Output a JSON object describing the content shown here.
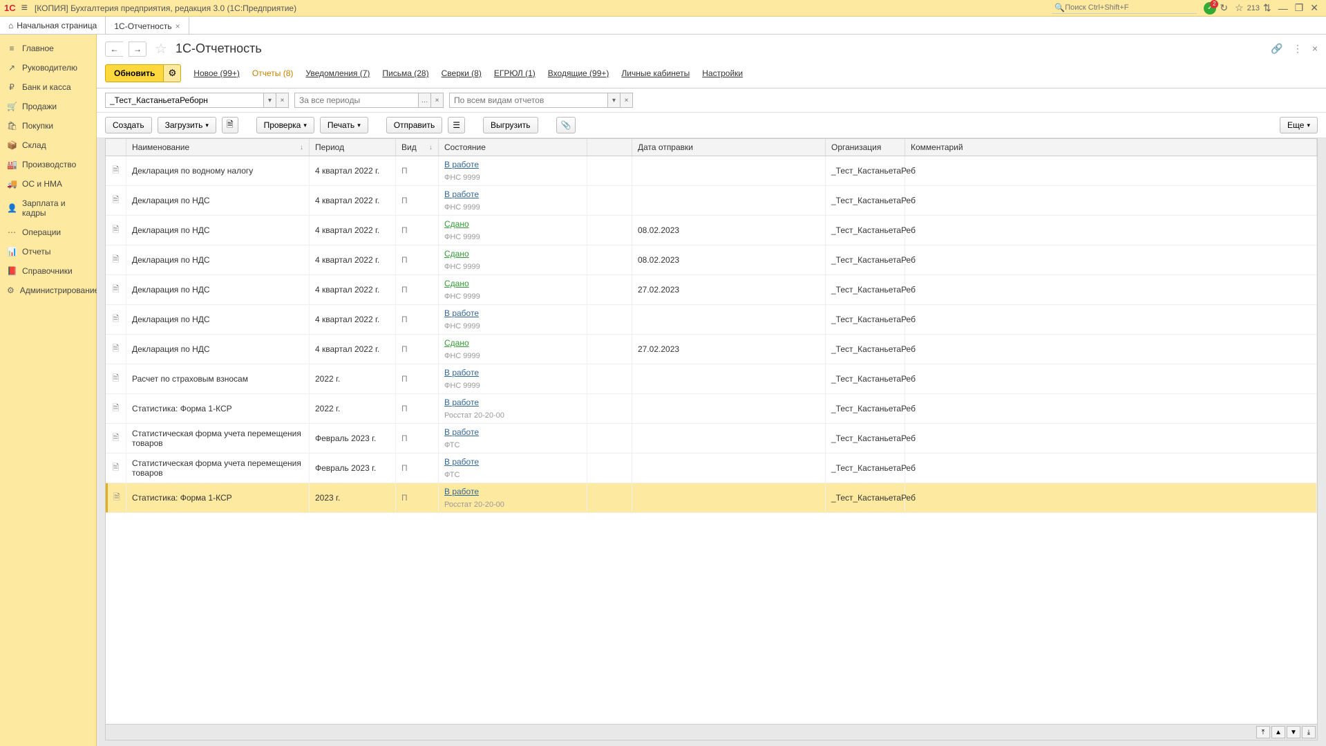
{
  "titlebar": {
    "logo": "1C",
    "title": "[КОПИЯ] Бухгалтерия предприятия, редакция 3.0  (1С:Предприятие)",
    "search_placeholder": "Поиск Ctrl+Shift+F",
    "notif_badge": "2",
    "count": "213"
  },
  "tabs": {
    "home": "Начальная страница",
    "active": "1С-Отчетность"
  },
  "sidebar": {
    "items": [
      {
        "icon": "≡",
        "label": "Главное"
      },
      {
        "icon": "↗",
        "label": "Руководителю"
      },
      {
        "icon": "₽",
        "label": "Банк и касса"
      },
      {
        "icon": "🛒",
        "label": "Продажи"
      },
      {
        "icon": "🛍",
        "label": "Покупки"
      },
      {
        "icon": "📦",
        "label": "Склад"
      },
      {
        "icon": "🏭",
        "label": "Производство"
      },
      {
        "icon": "🚚",
        "label": "ОС и НМА"
      },
      {
        "icon": "👤",
        "label": "Зарплата и кадры"
      },
      {
        "icon": "⋯",
        "label": "Операции"
      },
      {
        "icon": "📊",
        "label": "Отчеты"
      },
      {
        "icon": "📕",
        "label": "Справочники"
      },
      {
        "icon": "⚙",
        "label": "Администрирование"
      }
    ]
  },
  "page": {
    "title": "1С-Отчетность",
    "nav": {
      "refresh": "Обновить",
      "new": "Новое (99+)",
      "reports": "Отчеты (8)",
      "notifications": "Уведомления (7)",
      "letters": "Письма (28)",
      "checks": "Сверки (8)",
      "egrul": "ЕГРЮЛ (1)",
      "incoming": "Входящие (99+)",
      "cabinets": "Личные кабинеты",
      "settings": "Настройки"
    },
    "filters": {
      "org_value": "_Тест_КастаньетаРеборн",
      "period_placeholder": "За все периоды",
      "types_placeholder": "По всем видам отчетов"
    },
    "toolbar": {
      "create": "Создать",
      "load": "Загрузить",
      "check": "Проверка",
      "print": "Печать",
      "send": "Отправить",
      "export": "Выгрузить",
      "more": "Еще"
    },
    "columns": {
      "name": "Наименование",
      "period": "Период",
      "type": "Вид",
      "status": "Состояние",
      "date": "Дата отправки",
      "org": "Организация",
      "comment": "Комментарий"
    },
    "rows": [
      {
        "name": "Декларация по водному налогу",
        "period": "4 квартал 2022 г.",
        "type": "П",
        "status": "В работе",
        "status_color": "blue",
        "sub": "ФНС 9999",
        "date": "",
        "org": "_Тест_КастаньетаРеб"
      },
      {
        "name": "Декларация по НДС",
        "period": "4 квартал 2022 г.",
        "type": "П",
        "status": "В работе",
        "status_color": "blue",
        "sub": "ФНС 9999",
        "date": "",
        "org": "_Тест_КастаньетаРеб"
      },
      {
        "name": "Декларация по НДС",
        "period": "4 квартал 2022 г.",
        "type": "П",
        "status": "Сдано",
        "status_color": "green",
        "sub": "ФНС 9999",
        "date": "08.02.2023",
        "org": "_Тест_КастаньетаРеб"
      },
      {
        "name": "Декларация по НДС",
        "period": "4 квартал 2022 г.",
        "type": "П",
        "status": "Сдано",
        "status_color": "green",
        "sub": "ФНС 9999",
        "date": "08.02.2023",
        "org": "_Тест_КастаньетаРеб"
      },
      {
        "name": "Декларация по НДС",
        "period": "4 квартал 2022 г.",
        "type": "П",
        "status": "Сдано",
        "status_color": "green",
        "sub": "ФНС 9999",
        "date": "27.02.2023",
        "org": "_Тест_КастаньетаРеб"
      },
      {
        "name": "Декларация по НДС",
        "period": "4 квартал 2022 г.",
        "type": "П",
        "status": "В работе",
        "status_color": "blue",
        "sub": "ФНС 9999",
        "date": "",
        "org": "_Тест_КастаньетаРеб"
      },
      {
        "name": "Декларация по НДС",
        "period": "4 квартал 2022 г.",
        "type": "П",
        "status": "Сдано",
        "status_color": "green",
        "sub": "ФНС 9999",
        "date": "27.02.2023",
        "org": "_Тест_КастаньетаРеб"
      },
      {
        "name": "Расчет по страховым взносам",
        "period": "2022 г.",
        "type": "П",
        "status": "В работе",
        "status_color": "blue",
        "sub": "ФНС 9999",
        "date": "",
        "org": "_Тест_КастаньетаРеб"
      },
      {
        "name": "Статистика: Форма 1-КСР",
        "period": "2022 г.",
        "type": "П",
        "status": "В работе",
        "status_color": "blue",
        "sub": "Росстат 20-20-00",
        "date": "",
        "org": "_Тест_КастаньетаРеб"
      },
      {
        "name": "Статистическая форма учета перемещения товаров",
        "period": "Февраль 2023 г.",
        "type": "П",
        "status": "В работе",
        "status_color": "blue",
        "sub": "ФТС",
        "date": "",
        "org": "_Тест_КастаньетаРеб"
      },
      {
        "name": "Статистическая форма учета перемещения товаров",
        "period": "Февраль 2023 г.",
        "type": "П",
        "status": "В работе",
        "status_color": "blue",
        "sub": "ФТС",
        "date": "",
        "org": "_Тест_КастаньетаРеб"
      },
      {
        "name": "Статистика: Форма 1-КСР",
        "period": "2023 г.",
        "type": "П",
        "status": "В работе",
        "status_color": "blue",
        "sub": "Росстат 20-20-00",
        "date": "",
        "org": "_Тест_КастаньетаРеб",
        "selected": true
      }
    ]
  }
}
